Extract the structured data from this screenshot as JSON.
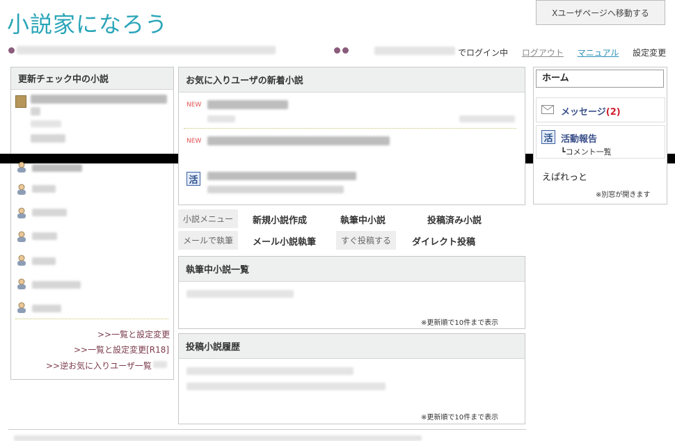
{
  "logo": {
    "text": "小説家になろう"
  },
  "header": {
    "x_button": "Xユーザページへ移動する",
    "login_suffix": "でログイン中",
    "nav": [
      "ログアウト",
      "マニュアル",
      "設定変更"
    ]
  },
  "left": {
    "title": "更新チェック中の小説",
    "links": [
      ">>一覧と設定変更",
      ">>一覧と設定変更[R18]",
      ">>逆お気に入りユーザ一覧"
    ]
  },
  "favorites": {
    "title": "お気に入りユーザの新着小説",
    "new_label": "NEW",
    "katsudo_icon": "活"
  },
  "menu": {
    "row1": {
      "tag": "小説メニュー",
      "items": [
        "新規小説作成",
        "執筆中小説",
        "投稿済み小説"
      ]
    },
    "row2": [
      {
        "tag": "メールで執筆",
        "item": "メール小説執筆"
      },
      {
        "tag": "すぐ投稿する",
        "item": "ダイレクト投稿"
      }
    ]
  },
  "drafts": {
    "title": "執筆中小説一覧",
    "note": "※更新順で10件まで表示"
  },
  "history": {
    "title": "投稿小説履歴",
    "note": "※更新順で10件まで表示"
  },
  "right": {
    "home": "ホーム",
    "messages_label": "メッセージ",
    "messages_count": "(2)",
    "activity_label": "活動報告",
    "activity_icon": "活",
    "comment_list": "┗コメント一覧",
    "ebaretto": "えぱれっと",
    "popup_note": "※別窓が開きます"
  }
}
